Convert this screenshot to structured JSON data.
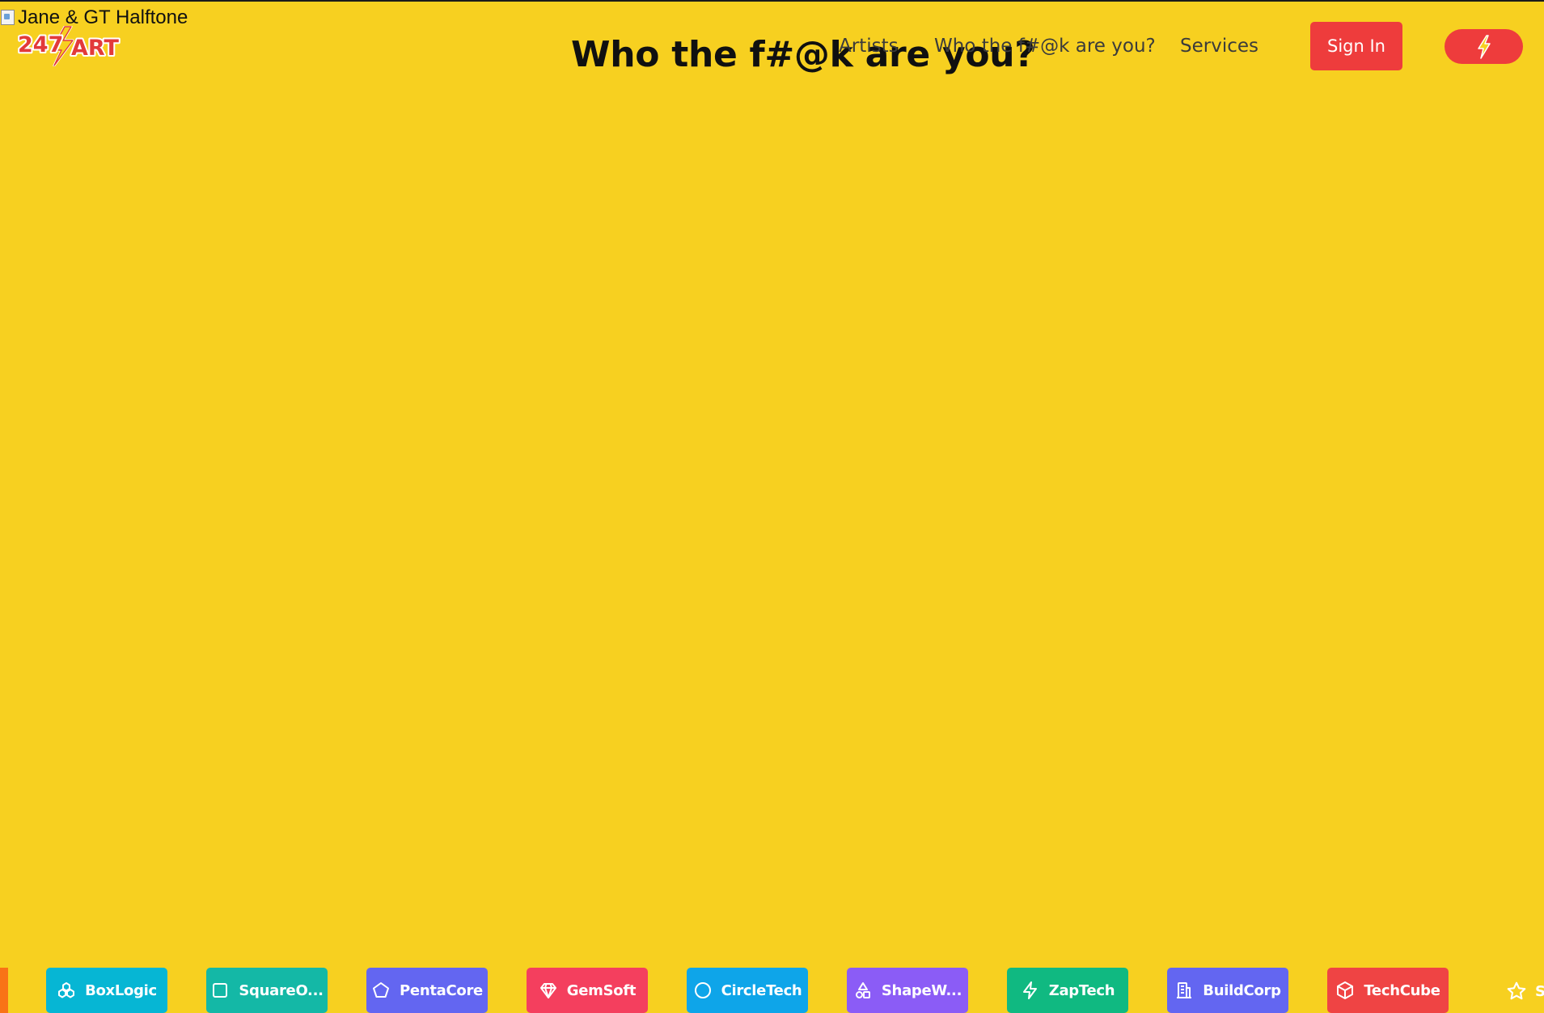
{
  "page": {
    "image_alt": "Jane & GT Halftone",
    "headline": "Who the f#@k are you?",
    "background_color": "#f7d020"
  },
  "brand": {
    "logo_text": "247ART",
    "colors": {
      "logo_red": "#e23a3a",
      "logo_yellow": "#f7d020"
    }
  },
  "nav": {
    "items": [
      {
        "label": "Artists"
      },
      {
        "label": "Who the f#@k are you?"
      },
      {
        "label": "Services"
      }
    ],
    "sign_in_label": "Sign In",
    "action_icon": "lightning-bolt-icon",
    "accent_color": "#ee3c3c"
  },
  "ticker": {
    "chips": [
      {
        "name": "BoxLogic",
        "icon": "boxes-icon",
        "color": "#06b6d4"
      },
      {
        "name": "SquareO...",
        "icon": "square-icon",
        "color": "#14b8a6"
      },
      {
        "name": "PentaCore",
        "icon": "pentagon-icon",
        "color": "#6366f1"
      },
      {
        "name": "GemSoft",
        "icon": "gem-icon",
        "color": "#f43f5e"
      },
      {
        "name": "CircleTech",
        "icon": "circle-icon",
        "color": "#0ea5e9"
      },
      {
        "name": "ShapeW...",
        "icon": "shapes-icon",
        "color": "#8b5cf6"
      },
      {
        "name": "ZapTech",
        "icon": "zap-icon",
        "color": "#10b981"
      },
      {
        "name": "BuildCorp",
        "icon": "building-icon",
        "color": "#6366f1"
      },
      {
        "name": "TechCube",
        "icon": "cube-icon",
        "color": "#ef4444"
      }
    ],
    "partial_chip": {
      "name": "S",
      "icon": "star-icon"
    },
    "edge_color": "#f97316"
  }
}
